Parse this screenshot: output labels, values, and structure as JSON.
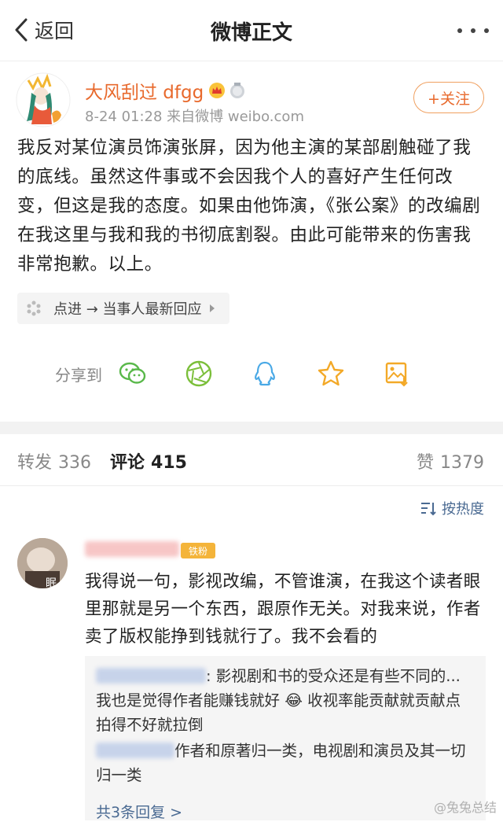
{
  "navbar": {
    "back_label": "返回",
    "title": "微博正文"
  },
  "post": {
    "user_name": "大风刮过 dfgg",
    "meta": "8-24 01:28  来自微博 weibo.com",
    "follow_label": "+关注",
    "text": "我反对某位演员饰演张屏，因为他主演的某部剧触碰了我的底线。虽然这件事或不会因我个人的喜好产生任何改变，但这是我的态度。如果由他饰演，《张公案》的改编剧在我这里与我和我的书彻底割裂。由此可能带来的伤害我非常抱歉。以上。",
    "topic_link": "点进 → 当事人最新回应",
    "share_label": "分享到"
  },
  "tabs": {
    "repost": {
      "label": "转发",
      "count": "336"
    },
    "comment": {
      "label": "评论",
      "count": "415"
    },
    "like": {
      "label": "赞",
      "count": "1379"
    }
  },
  "sort": {
    "label": "按热度"
  },
  "comment": {
    "fan_badge": "铁粉",
    "avatar_text": "眠",
    "text": "我得说一句，影视改编，不管谁演，在我这个读者眼里那就是另一个东西，跟原作无关。对我来说，作者卖了版权能挣到钱就行了。我不会看的",
    "replies": [
      {
        "text": ": 影视剧和书的受众还是有些不同的...我也是觉得作者能赚钱就好 😂 收视率能贡献就贡献点 拍得不好就拉倒"
      },
      {
        "text": "作者和原著归一类，电视剧和演员及其一切归一类"
      }
    ],
    "more_replies": "共3条回复 >"
  },
  "watermark": "@兔兔总结",
  "colors": {
    "accent_orange": "#e8692c",
    "link_blue": "#4a6a92",
    "follow_border": "#f0a060"
  }
}
